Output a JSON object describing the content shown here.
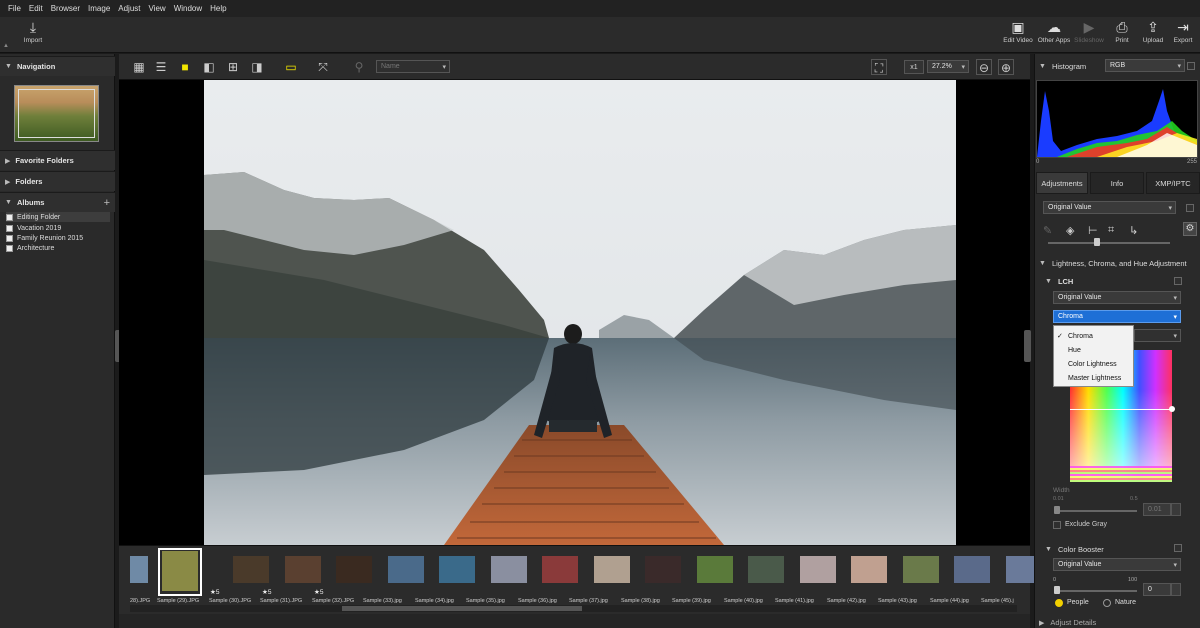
{
  "menu": [
    "File",
    "Edit",
    "Browser",
    "Image",
    "Adjust",
    "View",
    "Window",
    "Help"
  ],
  "toolbar": {
    "import": "Import",
    "right": [
      "Edit Video",
      "Other Apps",
      "Slideshow",
      "Print",
      "Upload",
      "Export"
    ]
  },
  "left": {
    "navigation": "Navigation",
    "favorite_folders": "Favorite Folders",
    "folders": "Folders",
    "albums": "Albums",
    "add": "+",
    "album_items": [
      "Editing Folder",
      "Vacation 2019",
      "Family Reunion 2015",
      "Architecture"
    ]
  },
  "viewer": {
    "filter_placeholder": "Name",
    "zoom_mult": "x1",
    "zoom_pct": "27.2%"
  },
  "filmstrip": {
    "labels": [
      "28).JPG",
      "Sample (29).JPG",
      "Sample (30).JPG",
      "Sample (31).JPG",
      "Sample (32).JPG",
      "Sample (33).jpg",
      "Sample (34).jpg",
      "Sample (35).jpg",
      "Sample (36).jpg",
      "Sample (37).jpg",
      "Sample (38).jpg",
      "Sample (39).jpg",
      "Sample (40).jpg",
      "Sample (41).jpg",
      "Sample (42).jpg",
      "Sample (43).jpg",
      "Sample (44).jpg",
      "Sample (45).j"
    ],
    "stars": [
      "★5",
      "★5",
      "★5"
    ],
    "thumb_colors": [
      "#6f8aa6",
      "#8a8a45",
      "#4a3a2a",
      "#5a4030",
      "#3a2a20",
      "#4a6a8a",
      "#3a6a8a",
      "#8a8fa0",
      "#8a3a3a",
      "#b0a090",
      "#3a2a2a",
      "#5a7a3a",
      "#4a5a4a",
      "#b0a0a0",
      "#c0a090",
      "#6a7a4a",
      "#5a6a8a",
      "#6a7a9a"
    ]
  },
  "right": {
    "histogram": "Histogram",
    "channel": "RGB",
    "hist_min": "0",
    "hist_max": "255",
    "tabs": [
      "Adjustments",
      "Info",
      "XMP/IPTC"
    ],
    "preset": "Original Value",
    "section_lch": "Lightness, Chroma, and Hue Adjustment",
    "lch": "LCH",
    "lch_preset": "Original Value",
    "lch_mode": "Chroma",
    "dropdown": [
      "Chroma",
      "Hue",
      "Color Lightness",
      "Master Lightness"
    ],
    "checkmark": "✓",
    "width_label": "Width",
    "width_min": "0.01",
    "width_max": "0.5",
    "width_value": "0.01",
    "exclude_gray": "Exclude Gray",
    "color_booster": "Color Booster",
    "cb_preset": "Original Value",
    "cb_min": "0",
    "cb_max": "100",
    "cb_value": "0",
    "people": "People",
    "nature": "Nature",
    "adjust_details": "Adjust Details"
  }
}
